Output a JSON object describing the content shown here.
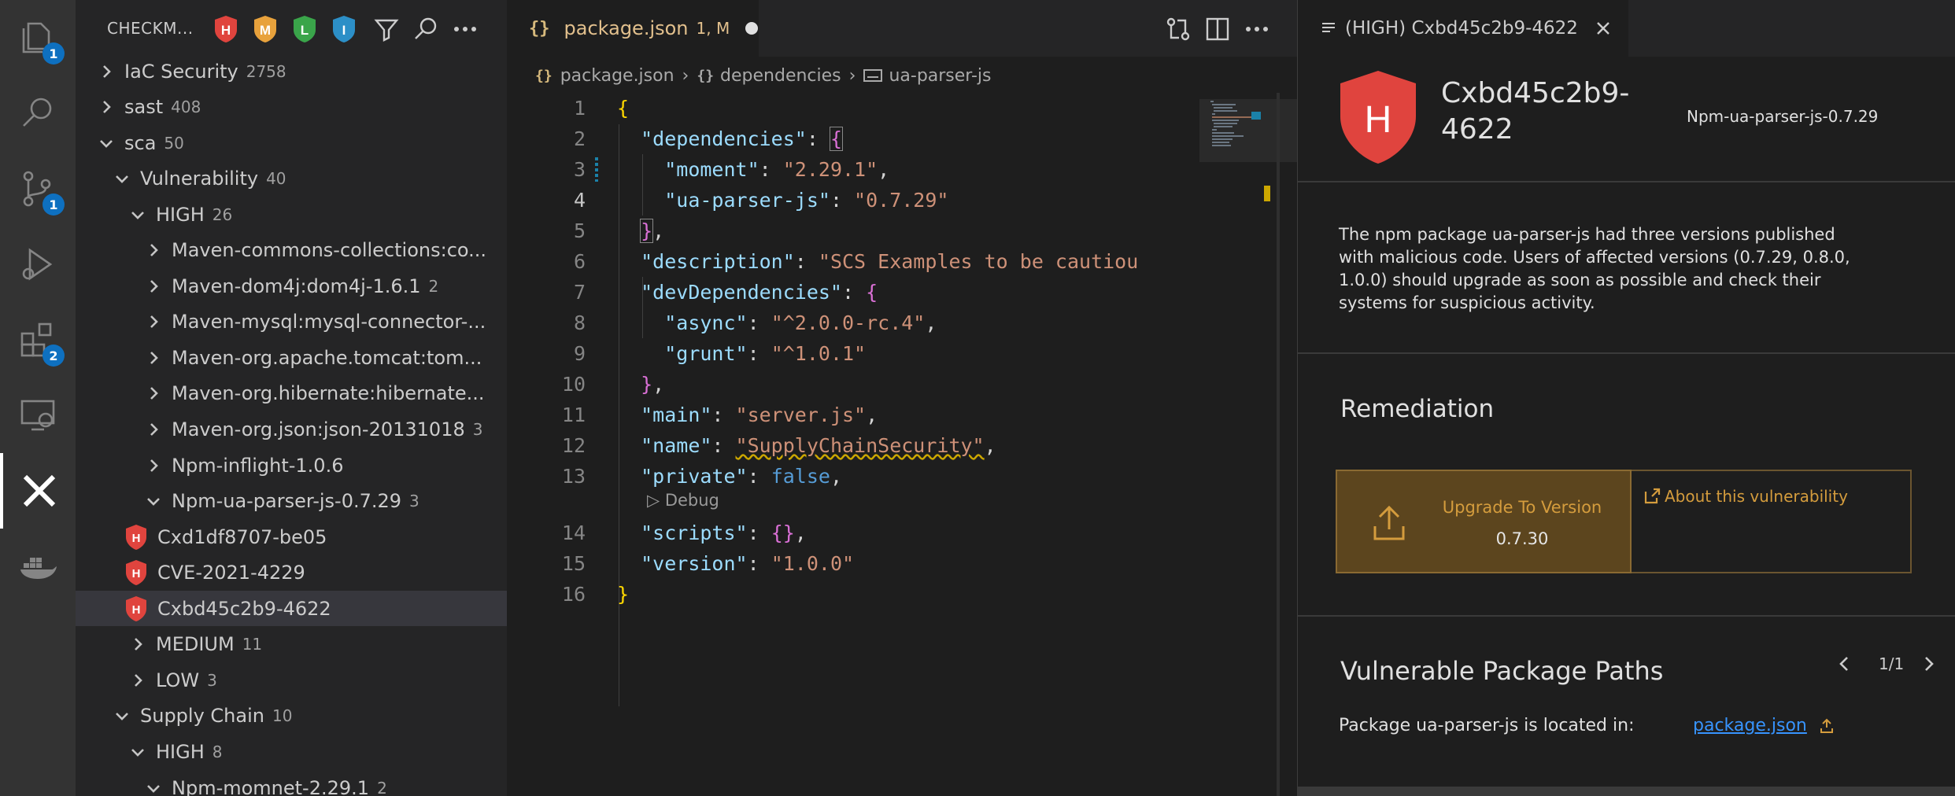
{
  "activity_bar": {
    "items": [
      {
        "name": "explorer",
        "badge": "1"
      },
      {
        "name": "search",
        "badge": ""
      },
      {
        "name": "source-control",
        "badge": "1"
      },
      {
        "name": "run-debug",
        "badge": ""
      },
      {
        "name": "extensions",
        "badge": "2"
      },
      {
        "name": "remote-explorer",
        "badge": ""
      },
      {
        "name": "checkmarx",
        "badge": ""
      },
      {
        "name": "docker",
        "badge": ""
      }
    ]
  },
  "sidebar": {
    "title": "CHECKM...",
    "severity_filters": [
      {
        "letter": "H",
        "color": "#e0443e"
      },
      {
        "letter": "M",
        "color": "#e8a23c"
      },
      {
        "letter": "L",
        "color": "#3aa54a"
      },
      {
        "letter": "I",
        "color": "#2c8fc7"
      }
    ],
    "tree": [
      {
        "label": "IaC Security",
        "count": "2758",
        "level": 1,
        "chevron": "right"
      },
      {
        "label": "sast",
        "count": "408",
        "level": 1,
        "chevron": "right"
      },
      {
        "label": "sca",
        "count": "50",
        "level": 1,
        "chevron": "down"
      },
      {
        "label": "Vulnerability",
        "count": "40",
        "level": 2,
        "chevron": "down"
      },
      {
        "label": "HIGH",
        "count": "26",
        "level": 3,
        "chevron": "down"
      },
      {
        "label": "Maven-commons-collections:co...",
        "count": "",
        "level": 4,
        "chevron": "right"
      },
      {
        "label": "Maven-dom4j:dom4j-1.6.1",
        "count": "2",
        "level": 4,
        "chevron": "right"
      },
      {
        "label": "Maven-mysql:mysql-connector-...",
        "count": "",
        "level": 4,
        "chevron": "right"
      },
      {
        "label": "Maven-org.apache.tomcat:tom...",
        "count": "",
        "level": 4,
        "chevron": "right"
      },
      {
        "label": "Maven-org.hibernate:hibernate...",
        "count": "",
        "level": 4,
        "chevron": "right"
      },
      {
        "label": "Maven-org.json:json-20131018",
        "count": "3",
        "level": 4,
        "chevron": "right"
      },
      {
        "label": "Npm-inflight-1.0.6",
        "count": "",
        "level": 4,
        "chevron": "right"
      },
      {
        "label": "Npm-ua-parser-js-0.7.29",
        "count": "3",
        "level": 4,
        "chevron": "down"
      },
      {
        "label": "Cxd1df8707-be05",
        "count": "",
        "level": 5,
        "chevron": "shield"
      },
      {
        "label": "CVE-2021-4229",
        "count": "",
        "level": 5,
        "chevron": "shield"
      },
      {
        "label": "Cxbd45c2b9-4622",
        "count": "",
        "level": 5,
        "chevron": "shield",
        "selected": true
      },
      {
        "label": "MEDIUM",
        "count": "11",
        "level": 3,
        "chevron": "right"
      },
      {
        "label": "LOW",
        "count": "3",
        "level": 3,
        "chevron": "right"
      },
      {
        "label": "Supply Chain",
        "count": "10",
        "level": 2,
        "chevron": "down"
      },
      {
        "label": "HIGH",
        "count": "8",
        "level": 3,
        "chevron": "down"
      },
      {
        "label": "Npm-momnet-2.29.1",
        "count": "2",
        "level": 4,
        "chevron": "down"
      }
    ]
  },
  "editor": {
    "tab": {
      "label": "package.json",
      "status": "1, M",
      "icon": "{}"
    },
    "breadcrumb": [
      "package.json",
      "dependencies",
      "ua-parser-js"
    ],
    "codelens": "Debug",
    "lines": [
      {
        "n": "1"
      },
      {
        "n": "2"
      },
      {
        "n": "3"
      },
      {
        "n": "4"
      },
      {
        "n": "5"
      },
      {
        "n": "6"
      },
      {
        "n": "7"
      },
      {
        "n": "8"
      },
      {
        "n": "9"
      },
      {
        "n": "10"
      },
      {
        "n": "11"
      },
      {
        "n": "12"
      },
      {
        "n": "13"
      },
      {
        "n": "14"
      },
      {
        "n": "15"
      },
      {
        "n": "16"
      }
    ],
    "code": {
      "l2_key": "\"dependencies\"",
      "l3_key": "\"moment\"",
      "l3_val": "\"2.29.1\"",
      "l4_key": "\"ua-parser-js\"",
      "l4_val": "\"0.7.29\"",
      "l6_key": "\"description\"",
      "l6_val": "\"SCS Examples to be cautiou",
      "l7_key": "\"devDependencies\"",
      "l8_key": "\"async\"",
      "l8_val": "\"^2.0.0-rc.4\"",
      "l9_key": "\"grunt\"",
      "l9_val": "\"^1.0.1\"",
      "l11_key": "\"main\"",
      "l11_val": "\"server.js\"",
      "l12_key": "\"name\"",
      "l12_val": "\"SupplyChainSecurity\"",
      "l13_key": "\"private\"",
      "l13_val": "false",
      "l14_key": "\"scripts\"",
      "l15_key": "\"version\"",
      "l15_val": "\"1.0.0\""
    }
  },
  "details": {
    "tab_title": "(HIGH) Cxbd45c2b9-4622",
    "severity_letter": "H",
    "vuln_id": "Cxbd45c2b9-4622",
    "package": "Npm-ua-parser-js-0.7.29",
    "description": "The npm package ua-parser-js had three versions published with malicious code. Users of affected versions (0.7.29, 0.8.0, 1.0.0) should upgrade as soon as possible and check their systems for suspicious activity.",
    "remediation_title": "Remediation",
    "upgrade_label": "Upgrade To Version",
    "upgrade_version": "0.7.30",
    "about_link": "About this vulnerability",
    "paths_title": "Vulnerable Package Paths",
    "pager": "1/1",
    "path_label": "Package ua-parser-js is located in:",
    "path_link": "package.json"
  }
}
